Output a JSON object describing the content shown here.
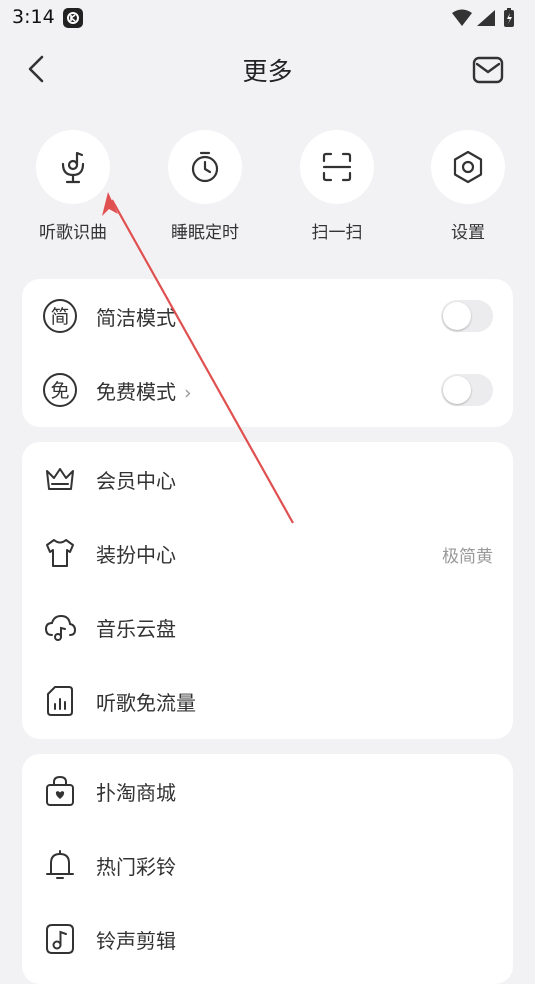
{
  "status_bar": {
    "time": "3:14",
    "app_icon": "kuwo-app-icon"
  },
  "header": {
    "title": "更多",
    "back_icon": "chevron-left-icon",
    "mail_icon": "mail-icon"
  },
  "quick_actions": [
    {
      "label": "听歌识曲",
      "icon": "microphone-music-icon"
    },
    {
      "label": "睡眠定时",
      "icon": "timer-icon"
    },
    {
      "label": "扫一扫",
      "icon": "scan-icon"
    },
    {
      "label": "设置",
      "icon": "settings-hexagon-icon"
    }
  ],
  "mode_card": {
    "items": [
      {
        "label": "简洁模式",
        "icon_char": "简",
        "enabled": false
      },
      {
        "label": "免费模式",
        "icon_char": "免",
        "chevron": "›",
        "enabled": false
      }
    ]
  },
  "member_card": {
    "items": [
      {
        "label": "会员中心",
        "icon": "crown-icon"
      },
      {
        "label": "装扮中心",
        "icon": "tshirt-icon",
        "value": "极简黄"
      },
      {
        "label": "音乐云盘",
        "icon": "cloud-music-icon"
      },
      {
        "label": "听歌免流量",
        "icon": "data-sim-icon"
      }
    ]
  },
  "shop_card": {
    "items": [
      {
        "label": "扑淘商城",
        "icon": "shopping-bag-icon"
      },
      {
        "label": "热门彩铃",
        "icon": "bell-icon"
      },
      {
        "label": "铃声剪辑",
        "icon": "music-note-icon"
      }
    ]
  },
  "colors": {
    "background": "#f2f2f5",
    "card": "#ffffff",
    "text": "#333333",
    "secondary_text": "#999999",
    "annotation_arrow": "#e05050"
  }
}
